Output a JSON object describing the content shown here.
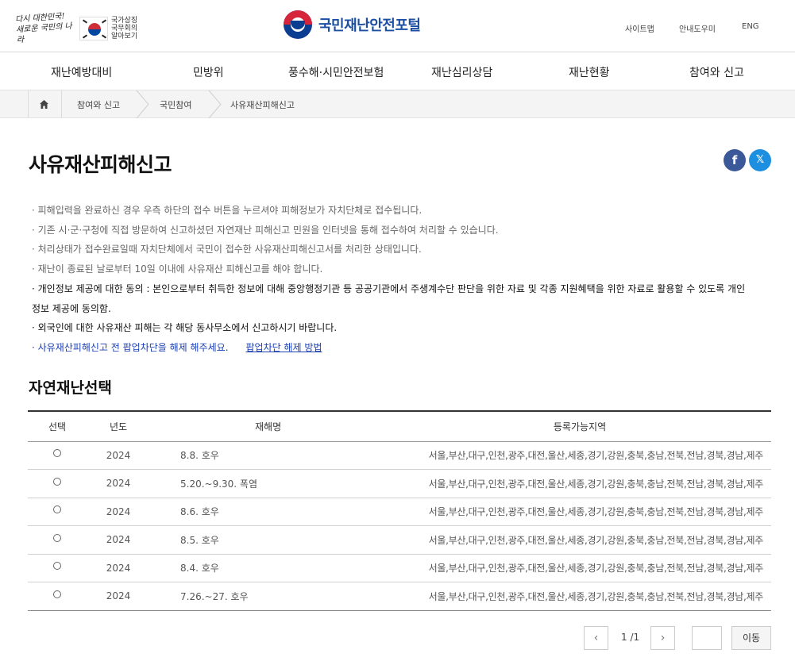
{
  "header": {
    "slogan": "다시 대한민국! 새로운 국민의 나라",
    "agency": "국가상징 국무회의 알아보기",
    "portal_title": "국민재난안전포털",
    "util_links": [
      "사이트맵",
      "안내도우미",
      "ENG"
    ]
  },
  "nav": [
    "재난예방대비",
    "민방위",
    "풍수해·시민안전보험",
    "재난심리상담",
    "재난현황",
    "참여와 신고"
  ],
  "breadcrumb": [
    "참여와 신고",
    "국민참여",
    "사유재산피해신고"
  ],
  "page": {
    "title": "사유재산피해신고",
    "sns": {
      "facebook": "f",
      "x": "𝕏"
    },
    "notes": [
      "· 피해입력을 완료하신 경우 우측 하단의 접수 버튼을 누르셔야 피해정보가 자치단체로 접수됩니다.",
      "· 기존 시·군·구청에 직접 방문하여 신고하셨던 자연재난 피해신고 민원을 인터넷을 통해 접수하여 처리할 수 있습니다.",
      "· 처리상태가 접수완료일때 자치단체에서 국민이 접수한 사유재산피해신고서를 처리한 상태입니다.",
      "· 재난이 종료된 날로부터 10일 이내에 사유재산 피해신고를 해야 합니다.",
      "· 개인정보 제공에 대한 동의 : 본인으로부터 취득한 정보에 대해 중앙행정기관 등 공공기관에서 주생계수단 판단을 위한 자료 및 각종 지원혜택을 위한 자료로 활용할 수 있도록 개인정보 제공에 동의함.",
      "· 외국인에 대한 사유재산 피해는 각 해당 동사무소에서 신고하시기 바랍니다.",
      "· 사유재산피해신고 전 팝업차단을 해제 해주세요."
    ],
    "popup_link": "팝업차단 해제 방법",
    "section_title": "자연재난선택"
  },
  "table": {
    "headers": [
      "선택",
      "년도",
      "재해명",
      "등록가능지역"
    ],
    "rows": [
      {
        "year": "2024",
        "name": "8.8. 호우",
        "region": "서울,부산,대구,인천,광주,대전,울산,세종,경기,강원,충북,충남,전북,전남,경북,경남,제주"
      },
      {
        "year": "2024",
        "name": "5.20.~9.30. 폭염",
        "region": "서울,부산,대구,인천,광주,대전,울산,세종,경기,강원,충북,충남,전북,전남,경북,경남,제주"
      },
      {
        "year": "2024",
        "name": "8.6. 호우",
        "region": "서울,부산,대구,인천,광주,대전,울산,세종,경기,강원,충북,충남,전북,전남,경북,경남,제주"
      },
      {
        "year": "2024",
        "name": "8.5. 호우",
        "region": "서울,부산,대구,인천,광주,대전,울산,세종,경기,강원,충북,충남,전북,전남,경북,경남,제주"
      },
      {
        "year": "2024",
        "name": "8.4. 호우",
        "region": "서울,부산,대구,인천,광주,대전,울산,세종,경기,강원,충북,충남,전북,전남,경북,경남,제주"
      },
      {
        "year": "2024",
        "name": "7.26.~27. 호우",
        "region": "서울,부산,대구,인천,광주,대전,울산,세종,경기,강원,충북,충남,전북,전남,경북,경남,제주"
      }
    ]
  },
  "pager": {
    "prev": "‹",
    "info": "1 /1",
    "next": "›",
    "go": "이동"
  },
  "colors": {
    "brand_blue": "#1c4fa3",
    "facebook": "#3b5998",
    "x": "#1d8fe0",
    "link_blue": "#1a3fb5"
  }
}
